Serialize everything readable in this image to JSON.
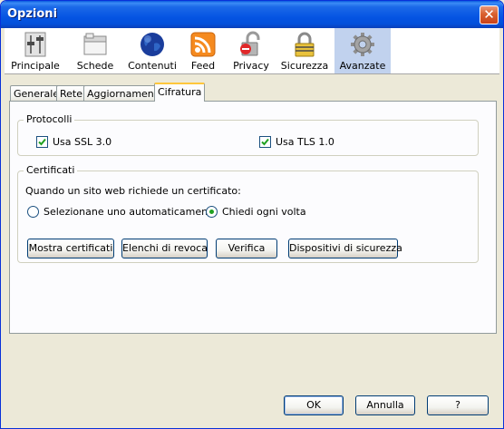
{
  "window": {
    "title": "Opzioni",
    "close_label": "✕"
  },
  "panes": [
    {
      "label": "Principale",
      "icon": "general-settings-icon"
    },
    {
      "label": "Schede",
      "icon": "tabs-icon"
    },
    {
      "label": "Contenuti",
      "icon": "globe-icon"
    },
    {
      "label": "Feed",
      "icon": "rss-feed-icon"
    },
    {
      "label": "Privacy",
      "icon": "privacy-lock-icon"
    },
    {
      "label": "Sicurezza",
      "icon": "security-padlock-icon"
    },
    {
      "label": "Avanzate",
      "icon": "gear-icon"
    }
  ],
  "selected_pane": "Avanzate",
  "tabs": [
    "Generale",
    "Rete",
    "Aggiornamenti",
    "Cifratura"
  ],
  "active_tab": "Cifratura",
  "protocols": {
    "legend": "Protocolli",
    "ssl_label": "Usa SSL 3.0",
    "ssl_checked": true,
    "tls_label": "Usa TLS 1.0",
    "tls_checked": true
  },
  "certificates": {
    "legend": "Certificati",
    "prompt": "Quando un sito web richiede un certificato:",
    "option_auto": "Selezionane uno automaticamente",
    "option_ask": "Chiedi ogni volta",
    "selected_option": "Chiedi ogni volta",
    "buttons": [
      "Mostra certificati",
      "Elenchi di revoca",
      "Verifica",
      "Dispositivi di sicurezza"
    ]
  },
  "footer": {
    "ok": "OK",
    "cancel": "Annulla",
    "help": "?"
  },
  "colors": {
    "titlebar": "#0554e3",
    "dialog": "#ece9d8",
    "selected_pane": "#c1d2ee",
    "tab_highlight": "#ffc73c",
    "radio_dot": "#21a121"
  }
}
